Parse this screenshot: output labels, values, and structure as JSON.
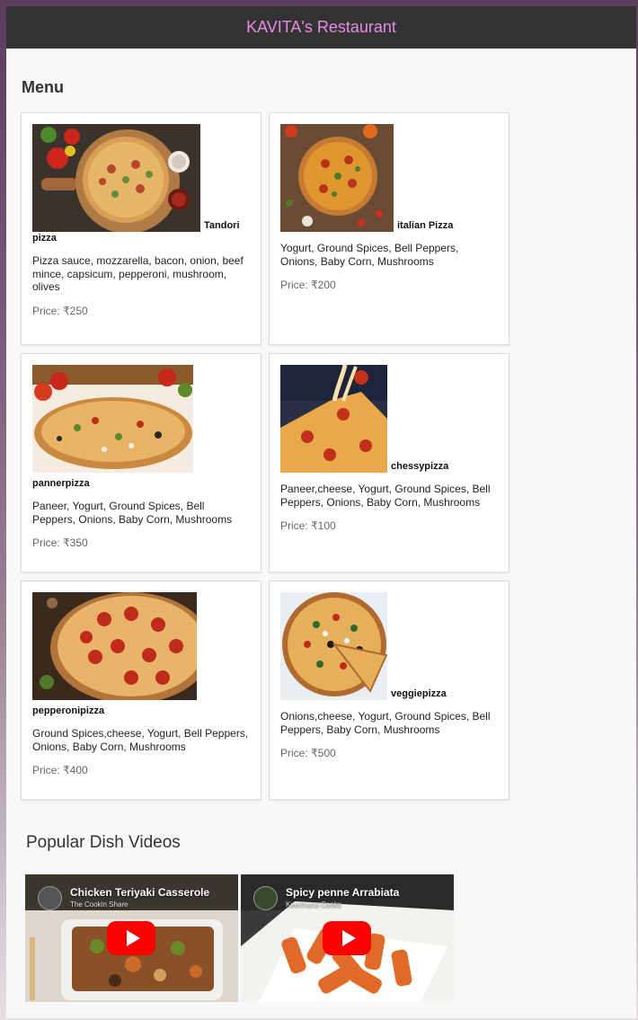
{
  "header": {
    "title": "KAVITA's Restaurant",
    "title_color": "#e88be6",
    "bar_color": "#333333"
  },
  "menu": {
    "heading": "Menu",
    "items": [
      {
        "name": "Tandori pizza",
        "desc": "Pizza sauce, mozzarella, bacon, onion, beef mince, capsicum, pepperoni, mushroom, olives",
        "price": "Price: ₹250"
      },
      {
        "name": "italian Pizza",
        "desc": "Yogurt, Ground Spices, Bell Peppers, Onions, Baby Corn, Mushrooms",
        "price": "Price: ₹200"
      },
      {
        "name": "pannerpizza",
        "desc": "Paneer, Yogurt, Ground Spices, Bell Peppers, Onions, Baby Corn, Mushrooms",
        "price": "Price: ₹350"
      },
      {
        "name": "chessypizza",
        "desc": "Paneer,cheese, Yogurt, Ground Spices, Bell Peppers, Onions, Baby Corn, Mushrooms",
        "price": "Price: ₹100"
      },
      {
        "name": "pepperonipizza",
        "desc": "Ground Spices,cheese, Yogurt, Bell Peppers, Onions, Baby Corn, Mushrooms",
        "price": "Price: ₹400"
      },
      {
        "name": "veggiepizza",
        "desc": "Onions,cheese, Yogurt, Ground Spices, Bell Peppers, Baby Corn, Mushrooms",
        "price": "Price: ₹500"
      }
    ]
  },
  "videos": {
    "heading": "Popular Dish Videos",
    "items": [
      {
        "title": "Chicken Teriyaki Casserole",
        "channel": "The Cookin Share"
      },
      {
        "title": "Spicy penne Arrabiata",
        "channel": "Keerthana Cooks"
      }
    ]
  }
}
